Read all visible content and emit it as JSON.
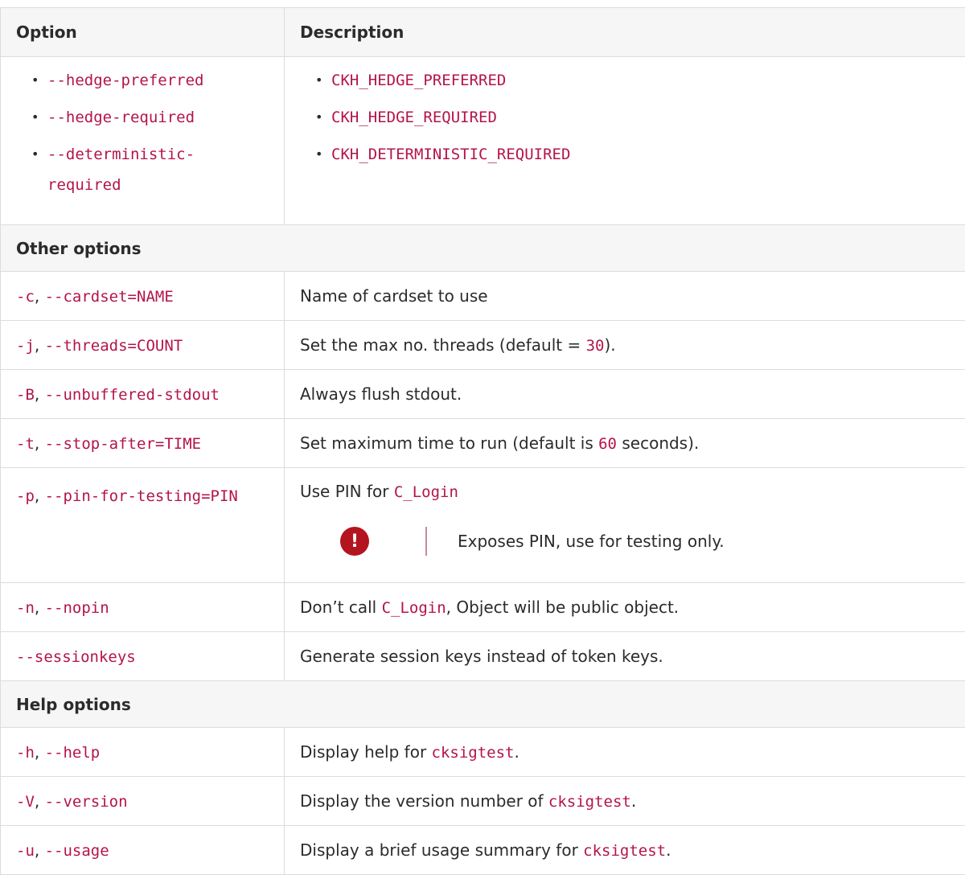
{
  "header": {
    "option": "Option",
    "description": "Description"
  },
  "hedge": {
    "options": [
      "--hedge-preferred",
      "--hedge-required",
      "--deterministic-",
      "required"
    ],
    "values": [
      "CKH_HEDGE_PREFERRED",
      "CKH_HEDGE_REQUIRED",
      "CKH_DETERMINISTIC_REQUIRED"
    ]
  },
  "other": {
    "title": "Other options",
    "rows": [
      {
        "short": "-c",
        "long": "--cardset=NAME",
        "desc": "Name of cardset to use"
      },
      {
        "short": "-j",
        "long": "--threads=COUNT",
        "desc_pre": "Set the max no. threads (default = ",
        "desc_code": "30",
        "desc_post": ")."
      },
      {
        "short": "-B",
        "long": "--unbuffered-stdout",
        "desc": "Always flush stdout."
      },
      {
        "short": "-t",
        "long": "--stop-after=TIME",
        "desc_pre": "Set maximum time to run (default is ",
        "desc_code": "60",
        "desc_post": " seconds)."
      },
      {
        "short": "-p",
        "long": "--pin-for-testing=PIN",
        "desc_pre": "Use PIN for ",
        "desc_code": "C_Login",
        "warning": "Exposes PIN, use for testing only."
      },
      {
        "short": "-n",
        "long": "--nopin",
        "desc_pre": "Don’t call ",
        "desc_code": "C_Login",
        "desc_post": ", Object will be public object."
      },
      {
        "long": "--sessionkeys",
        "desc": "Generate session keys instead of token keys."
      }
    ]
  },
  "help": {
    "title": "Help options",
    "rows": [
      {
        "short": "-h",
        "long": "--help",
        "desc_pre": "Display help for ",
        "desc_code": "cksigtest",
        "desc_post": "."
      },
      {
        "short": "-V",
        "long": "--version",
        "desc_pre": "Display the version number of ",
        "desc_code": "cksigtest",
        "desc_post": "."
      },
      {
        "short": "-u",
        "long": "--usage",
        "desc_pre": "Display a brief usage summary for ",
        "desc_code": "cksigtest",
        "desc_post": "."
      }
    ]
  },
  "separator": ", ",
  "icons": {
    "warning": "exclamation-icon"
  },
  "colors": {
    "code": "#b4144a",
    "warning": "#b4141f",
    "header_bg": "#f6f6f6"
  }
}
